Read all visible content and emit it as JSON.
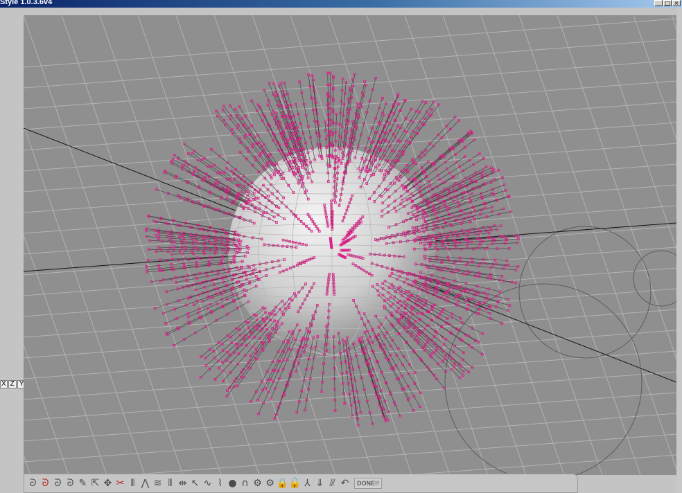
{
  "window": {
    "title": "Style 1.0.3.6v4",
    "controls": {
      "minimize": "_",
      "maximize": "□",
      "close": "×"
    }
  },
  "axis_buttons": [
    "X",
    "Z",
    "Y"
  ],
  "viewport": {
    "background_color": "#8f8f8f",
    "grid_color": "#b4b4b4",
    "sphere_color": "#d8d8d8",
    "spike_color": "#e0208a",
    "axis_line_color": "#111111",
    "guide_circle_color": "#5c5c5c"
  },
  "toolbar": {
    "tools": [
      {
        "icon": "curl-tool-icon",
        "glyph": "ᘐ"
      },
      {
        "icon": "curl-tool-2-icon",
        "glyph": "ᘐ",
        "accent": true
      },
      {
        "icon": "curl-tool-3-icon",
        "glyph": "ᘐ"
      },
      {
        "icon": "curl-tool-4-icon",
        "glyph": "ᘐ"
      },
      {
        "icon": "brush-icon",
        "glyph": "✎"
      },
      {
        "icon": "select-arrow-icon",
        "glyph": "⇱"
      },
      {
        "icon": "rotate-icon",
        "glyph": "✥"
      },
      {
        "icon": "cut-icon",
        "glyph": "✂",
        "accent": true
      },
      {
        "icon": "comb-icon",
        "glyph": "⫴"
      },
      {
        "icon": "clump-icon",
        "glyph": "⋀"
      },
      {
        "icon": "wave-icon",
        "glyph": "≋"
      },
      {
        "icon": "strands-icon",
        "glyph": "⦀"
      },
      {
        "icon": "scale-icon",
        "glyph": "⇹"
      },
      {
        "icon": "pick-icon",
        "glyph": "↖"
      },
      {
        "icon": "smooth-icon",
        "glyph": "∿"
      },
      {
        "icon": "kink-icon",
        "glyph": "⌇"
      },
      {
        "icon": "sphere-icon",
        "glyph": "●"
      },
      {
        "icon": "magnet-icon",
        "glyph": "∩"
      },
      {
        "icon": "gear-icon",
        "glyph": "⚙"
      },
      {
        "icon": "gear-2-icon",
        "glyph": "⚙"
      },
      {
        "icon": "lock-icon",
        "glyph": "🔒"
      },
      {
        "icon": "unlock-icon",
        "glyph": "🔓"
      },
      {
        "icon": "length-icon",
        "glyph": "⅄"
      },
      {
        "icon": "gravity-icon",
        "glyph": "⇓"
      },
      {
        "icon": "frizz-icon",
        "glyph": "⫻"
      },
      {
        "icon": "undo-icon",
        "glyph": "↶"
      }
    ],
    "done_label": "DONE!!"
  }
}
